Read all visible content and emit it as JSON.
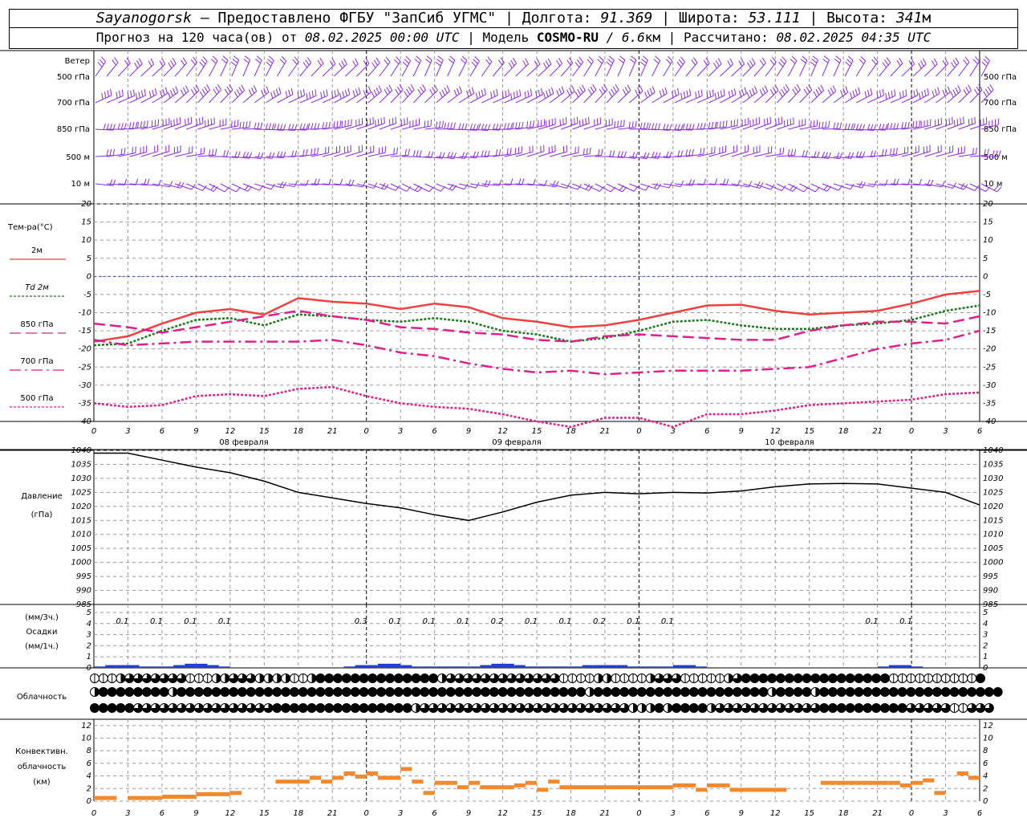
{
  "header": {
    "station": "Sayanogorsk",
    "provider": "– Предоставлено ФГБУ \"ЗапСиб УГМС\" |",
    "lon_label": "Долгота:",
    "lon_value": "91.369",
    "lat_label": "| Широта:",
    "lat_value": "53.111",
    "alt_label": "| Высота:",
    "alt_value": "341",
    "alt_unit": "м",
    "forecast_label": "Прогноз на 120 часа(ов) от",
    "forecast_start": "08.02.2025 00:00 UTC",
    "model_label": "| Модель",
    "model_name": "COSMO-RU",
    "model_res": "/ 6.6",
    "model_res_unit": "км",
    "computed_label": "| Рассчитано:",
    "computed_time": "08.02.2025 04:35 UTC"
  },
  "wind_panel": {
    "title": "Ветер",
    "levels": [
      "500 гПа",
      "700 гПа",
      "850 гПа",
      "500 м",
      "10 м"
    ],
    "color": "#8a2be2"
  },
  "time_axis": {
    "hour_ticks": [
      "0",
      "3",
      "6",
      "9",
      "12",
      "15",
      "18",
      "21",
      "0",
      "3",
      "6",
      "9",
      "12",
      "15",
      "18",
      "21",
      "0",
      "3",
      "6",
      "9",
      "12",
      "15",
      "18",
      "21",
      "0",
      "3",
      "6"
    ],
    "days": [
      "08 февраля",
      "09 февраля",
      "10 февраля"
    ]
  },
  "temperature_panel": {
    "title": "Тем-ра(°C)",
    "legend": [
      {
        "label": "2м",
        "color": "#f04040",
        "style": "solid"
      },
      {
        "label": "Td  2м",
        "color": "#1a7a1a",
        "style": "dotted"
      },
      {
        "label": "850 гПа",
        "color": "#e0208a",
        "style": "dashed"
      },
      {
        "label": "700 гПа",
        "color": "#e0208a",
        "style": "dashdot"
      },
      {
        "label": "500 гПа",
        "color": "#e0208a",
        "style": "dotted"
      }
    ],
    "yticks": [
      "20",
      "15",
      "10",
      "5",
      "0",
      "-5",
      "-10",
      "-15",
      "-20",
      "-25",
      "-30",
      "-35",
      "-40"
    ]
  },
  "pressure_panel": {
    "title": "Давление",
    "unit": "(гПа)",
    "yticks": [
      "1040",
      "1035",
      "1030",
      "1025",
      "1020",
      "1015",
      "1010",
      "1005",
      "1000",
      "995",
      "990",
      "985"
    ]
  },
  "precip_panel": {
    "unit3h": "(мм/3ч.)",
    "title": "Осадки",
    "unit1h": "(мм/1ч.)",
    "yticks": [
      "5",
      "4",
      "3",
      "2",
      "1",
      "0"
    ],
    "labels": [
      {
        "hour": 3,
        "text": "0.1"
      },
      {
        "hour": 6,
        "text": "0.1"
      },
      {
        "hour": 9,
        "text": "0.1"
      },
      {
        "hour": 12,
        "text": "0.1"
      },
      {
        "hour": 24,
        "text": "0.3"
      },
      {
        "hour": 27,
        "text": "0.1"
      },
      {
        "hour": 30,
        "text": "0.1"
      },
      {
        "hour": 33,
        "text": "0.1"
      },
      {
        "hour": 36,
        "text": "0.2"
      },
      {
        "hour": 39,
        "text": "0.1"
      },
      {
        "hour": 42,
        "text": "0.1"
      },
      {
        "hour": 45,
        "text": "0.2"
      },
      {
        "hour": 48,
        "text": "0.1"
      },
      {
        "hour": 51,
        "text": "0.1"
      },
      {
        "hour": 69,
        "text": "0.1"
      },
      {
        "hour": 72,
        "text": "0.1"
      }
    ]
  },
  "cloud_panel": {
    "title": "Облачность"
  },
  "convective_panel": {
    "title1": "Конвективн.",
    "title2": "облачность",
    "unit": "(км)",
    "yticks": [
      "12",
      "10",
      "8",
      "6",
      "4",
      "2",
      "0"
    ],
    "color": "#f08a30"
  },
  "chart_data": [
    {
      "type": "line",
      "title": "Тем-ра(°C)",
      "x_unit": "forecast hours from 08.02.2025 00:00 UTC",
      "ylim": [
        -40,
        20
      ],
      "grid": true,
      "x": [
        0,
        3,
        6,
        9,
        12,
        15,
        18,
        21,
        24,
        27,
        30,
        33,
        36,
        39,
        42,
        45,
        48,
        51,
        54,
        57,
        60,
        63,
        66,
        69,
        72,
        75,
        78
      ],
      "series": [
        {
          "name": "2м",
          "values": [
            -18,
            -16.5,
            -13,
            -10,
            -9,
            -10.5,
            -6,
            -7,
            -7.5,
            -9,
            -7.5,
            -8.5,
            -11.5,
            -12.5,
            -14,
            -13.5,
            -12,
            -10,
            -8,
            -7.8,
            -9.5,
            -10.5,
            -10,
            -9.5,
            -7.5,
            -5,
            -4
          ]
        },
        {
          "name": "Td  2м",
          "values": [
            -19,
            -18.5,
            -15,
            -12,
            -11.5,
            -13.5,
            -10.5,
            -11,
            -12,
            -12.5,
            -11.5,
            -12.5,
            -15,
            -16,
            -18,
            -17,
            -15,
            -12.5,
            -12,
            -13.5,
            -14.5,
            -14.5,
            -13.5,
            -13,
            -12,
            -9.5,
            -8
          ]
        },
        {
          "name": "850 гПа",
          "values": [
            -13,
            -14,
            -15.5,
            -14,
            -12.5,
            -11,
            -9.5,
            -11,
            -12,
            -14,
            -14.5,
            -15.5,
            -16,
            -17.5,
            -18,
            -16.5,
            -16,
            -16.5,
            -17,
            -17.5,
            -17.5,
            -15,
            -13.5,
            -12.5,
            -12.5,
            -13,
            -11
          ]
        },
        {
          "name": "700 гПа",
          "values": [
            -17.5,
            -19,
            -18.5,
            -18,
            -18,
            -18,
            -18,
            -17.5,
            -19,
            -21,
            -22,
            -24,
            -25.5,
            -26.5,
            -26,
            -27,
            -26.5,
            -26,
            -26,
            -26,
            -25.5,
            -25,
            -22.5,
            -20,
            -18.5,
            -17.5,
            -15
          ]
        },
        {
          "name": "500 гПа",
          "values": [
            -35,
            -36,
            -35.5,
            -33,
            -32.5,
            -33,
            -31,
            -30.5,
            -33,
            -35,
            -36,
            -36.5,
            -38,
            -40,
            -41.5,
            -39,
            -39,
            -41.5,
            -38,
            -38,
            -37,
            -35.5,
            -35,
            -34.5,
            -34,
            -32.5,
            -32
          ]
        }
      ]
    },
    {
      "type": "line",
      "title": "Давление",
      "ylabel": "(гПа)",
      "ylim": [
        985,
        1040
      ],
      "x": [
        0,
        3,
        6,
        9,
        12,
        15,
        18,
        21,
        24,
        27,
        30,
        33,
        36,
        39,
        42,
        45,
        48,
        51,
        54,
        57,
        60,
        63,
        66,
        69,
        72,
        75,
        78
      ],
      "series": [
        {
          "values": [
            1039,
            1039,
            1036.5,
            1034,
            1032,
            1029,
            1025,
            1023,
            1021,
            1019.5,
            1017,
            1015,
            1018,
            1021.5,
            1024,
            1025,
            1024.5,
            1025,
            1024.8,
            1025.5,
            1027,
            1028,
            1028.2,
            1028,
            1026.5,
            1025,
            1020.5
          ]
        }
      ]
    },
    {
      "type": "bar",
      "title": "Осадки",
      "ylabel": "(мм/1ч.)",
      "ylim": [
        0,
        5
      ],
      "x": [
        1,
        2,
        3,
        4,
        5,
        6,
        7,
        8,
        9,
        10,
        11,
        12,
        23,
        24,
        25,
        26,
        27,
        28,
        29,
        30,
        31,
        32,
        33,
        34,
        35,
        36,
        37,
        38,
        39,
        40,
        41,
        42,
        43,
        44,
        45,
        46,
        47,
        48,
        49,
        50,
        51,
        52,
        53,
        54,
        70,
        71,
        72,
        73
      ],
      "values": [
        0.05,
        0.1,
        0.1,
        0.1,
        0.05,
        0.05,
        0.05,
        0.1,
        0.15,
        0.15,
        0.1,
        0.05,
        0.05,
        0.1,
        0.1,
        0.15,
        0.15,
        0.1,
        0.05,
        0.05,
        0.05,
        0.05,
        0.05,
        0.05,
        0.1,
        0.15,
        0.15,
        0.1,
        0.05,
        0.05,
        0.05,
        0.05,
        0.05,
        0.1,
        0.1,
        0.1,
        0.1,
        0.05,
        0.05,
        0.05,
        0.05,
        0.1,
        0.1,
        0.05,
        0.05,
        0.1,
        0.1,
        0.05
      ]
    },
    {
      "type": "bar",
      "title": "Конвективн. облачность",
      "ylabel": "(км)",
      "ylim": [
        0,
        13
      ],
      "segments": [
        {
          "h0": 0,
          "h1": 2,
          "v": 0.5
        },
        {
          "h0": 3,
          "h1": 6,
          "v": 0.5
        },
        {
          "h0": 6,
          "h1": 9,
          "v": 0.7
        },
        {
          "h0": 9,
          "h1": 12,
          "v": 1.1
        },
        {
          "h0": 12,
          "h1": 13,
          "v": 1.3
        },
        {
          "h0": 16,
          "h1": 19,
          "v": 3.1
        },
        {
          "h0": 19,
          "h1": 20,
          "v": 3.7
        },
        {
          "h0": 20,
          "h1": 21,
          "v": 3.1
        },
        {
          "h0": 21,
          "h1": 22,
          "v": 3.7
        },
        {
          "h0": 22,
          "h1": 23,
          "v": 4.4
        },
        {
          "h0": 23,
          "h1": 24,
          "v": 3.9
        },
        {
          "h0": 24,
          "h1": 25,
          "v": 4.4
        },
        {
          "h0": 25,
          "h1": 27,
          "v": 3.7
        },
        {
          "h0": 27,
          "h1": 28,
          "v": 5.1
        },
        {
          "h0": 28,
          "h1": 29,
          "v": 3.1
        },
        {
          "h0": 29,
          "h1": 30,
          "v": 1.3
        },
        {
          "h0": 30,
          "h1": 32,
          "v": 2.9
        },
        {
          "h0": 32,
          "h1": 33,
          "v": 2.2
        },
        {
          "h0": 33,
          "h1": 34,
          "v": 2.9
        },
        {
          "h0": 34,
          "h1": 36,
          "v": 2.2
        },
        {
          "h0": 36,
          "h1": 37,
          "v": 2.2
        },
        {
          "h0": 37,
          "h1": 38,
          "v": 2.5
        },
        {
          "h0": 38,
          "h1": 39,
          "v": 2.9
        },
        {
          "h0": 39,
          "h1": 40,
          "v": 1.8
        },
        {
          "h0": 40,
          "h1": 41,
          "v": 3.1
        },
        {
          "h0": 41,
          "h1": 48,
          "v": 2.2
        },
        {
          "h0": 48,
          "h1": 51,
          "v": 2.2
        },
        {
          "h0": 51,
          "h1": 53,
          "v": 2.5
        },
        {
          "h0": 53,
          "h1": 54,
          "v": 1.8
        },
        {
          "h0": 54,
          "h1": 56,
          "v": 2.5
        },
        {
          "h0": 56,
          "h1": 61,
          "v": 1.8
        },
        {
          "h0": 64,
          "h1": 70,
          "v": 2.9
        },
        {
          "h0": 70,
          "h1": 71,
          "v": 2.9
        },
        {
          "h0": 71,
          "h1": 72,
          "v": 2.5
        },
        {
          "h0": 72,
          "h1": 73,
          "v": 2.9
        },
        {
          "h0": 73,
          "h1": 74,
          "v": 3.3
        },
        {
          "h0": 74,
          "h1": 75,
          "v": 1.3
        },
        {
          "h0": 76,
          "h1": 77,
          "v": 4.4
        },
        {
          "h0": 77,
          "h1": 78,
          "v": 3.7
        }
      ]
    },
    {
      "type": "table",
      "title": "Облачность",
      "rows": [
        "PPPTEEEEEEEPPPHHEEETHHHPPHFFFFFFFFFFFFFFHEEEEEEEEEEEEEPPPPHTPPPPTEEEPPPPPHEFFFFFFFFFFFFFFFFFPPPPPPPPPPF",
        "HFFFFFFFFHFFFFFFFFFFFFFFFFFFFFFFFFFFFFFFFFFFFFFFFFFFFFFFFHFFFFFFFFFFFFFFFFFFFFTFFFFHFFFFFFFFFFFFFFFFFFFFF",
        "FFFFFEEEEEEEEEEEEEEEEFFFFFFFFFFFFFFFFHEEEEEEEEEEEEEEEEEEEEEEEEHHHFTFFFFHEEEEEEEEEEEEFFFFFFFFFFEEEEEPPEEE"
      ]
    }
  ]
}
